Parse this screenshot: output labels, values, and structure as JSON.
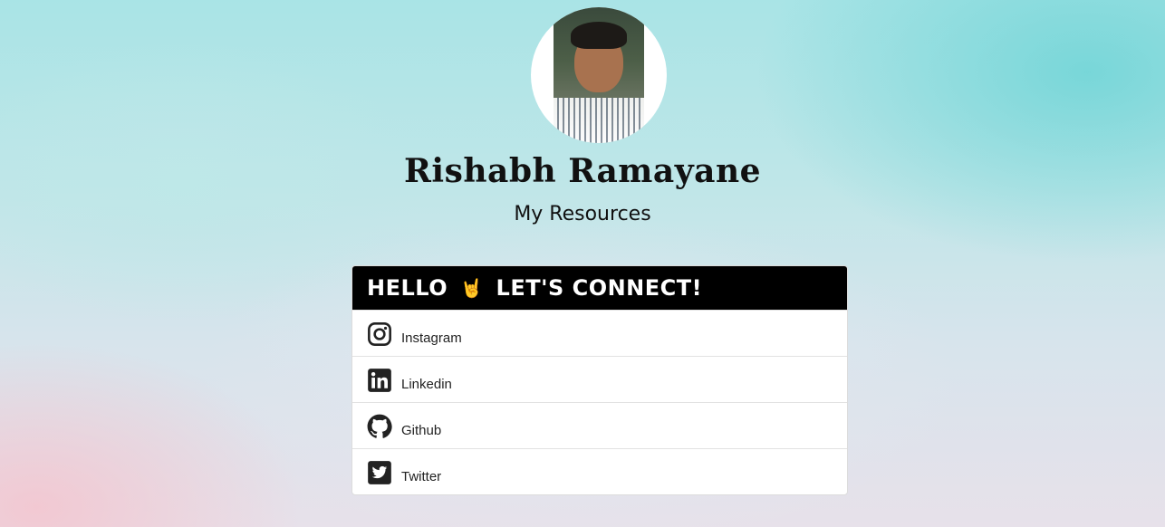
{
  "profile": {
    "name": "Rishabh Ramayane",
    "subtitle": "My Resources"
  },
  "card": {
    "header_left": "HELLO",
    "header_emoji": "🤘",
    "header_right": "LET'S CONNECT!",
    "links": [
      {
        "label": "Instagram",
        "icon": "instagram-icon"
      },
      {
        "label": "Linkedin",
        "icon": "linkedin-icon"
      },
      {
        "label": "Github",
        "icon": "github-icon"
      },
      {
        "label": "Twitter",
        "icon": "twitter-icon"
      }
    ]
  },
  "colors": {
    "header_bg": "#000000",
    "header_text": "#ffffff",
    "icon": "#222222"
  }
}
